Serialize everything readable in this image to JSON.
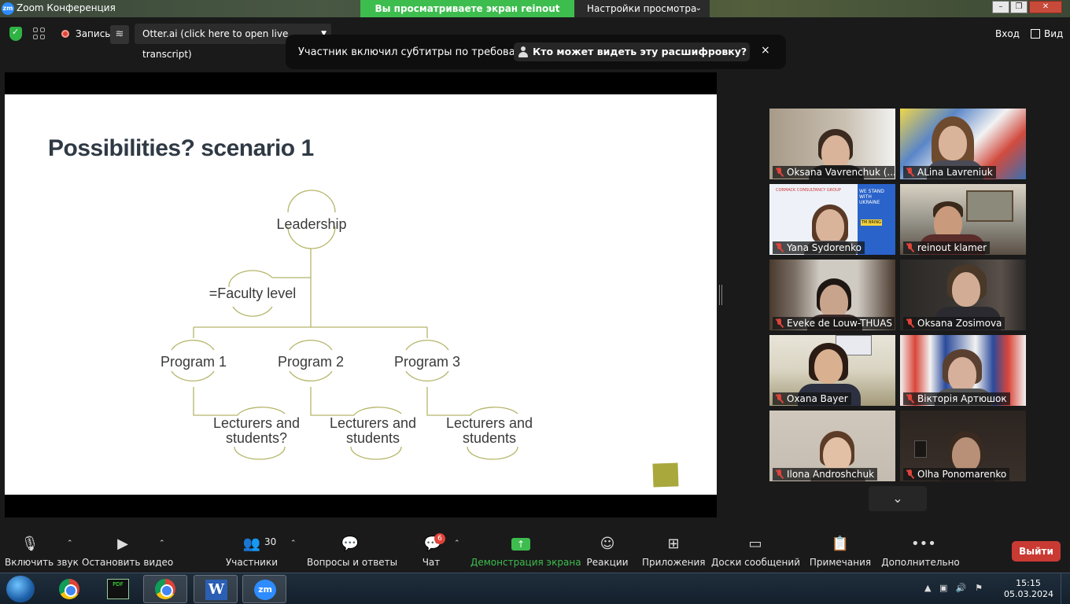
{
  "window": {
    "title": "Zoom Конференция",
    "logo_text": "zm",
    "share_banner": "Вы просматриваете экран reinout klamer",
    "view_settings": "Настройки просмотра",
    "minimize": "–",
    "restore": "❐",
    "close": "✕"
  },
  "topbar": {
    "record_label": "Запись",
    "otter_label": "Otter.ai (click here to open live transcript)",
    "enter_label": "Вход",
    "view_label": "Вид"
  },
  "notice": {
    "text": "Участник включил субтитры по требованию",
    "link": "Кто может видеть эту расшифровку? За...",
    "close": "×"
  },
  "slide": {
    "title": "Possibilities? scenario 1",
    "nodes": {
      "leadership": "Leadership",
      "faculty": "=Faculty level",
      "program1": "Program 1",
      "program2": "Program 2",
      "program3": "Program 3",
      "lect1_line1": "Lecturers and",
      "lect1_line2": "students?",
      "lect2_line1": "Lecturers and",
      "lect2_line2": "students",
      "lect3_line1": "Lecturers and",
      "lect3_line2": "students"
    }
  },
  "participants": [
    {
      "name": "Oksana Vavrenchuk (...",
      "muted": true
    },
    {
      "name": "ALina Lavreniuk",
      "muted": true
    },
    {
      "name": "Yana Sydorenko",
      "muted": true
    },
    {
      "name": "reinout klamer",
      "muted": true
    },
    {
      "name": "Eveke de Louw-THUAS",
      "muted": true
    },
    {
      "name": "Oksana Zosimova",
      "muted": true
    },
    {
      "name": "Oxana Bayer",
      "muted": true
    },
    {
      "name": "Вікторія Артюшок",
      "muted": true
    },
    {
      "name": "Ilona Androshchuk",
      "muted": true
    },
    {
      "name": "Olha Ponomarenko",
      "muted": true
    }
  ],
  "tile_banner": {
    "line1": "CORMACK CONSULTANCY GROUP",
    "line2": "WE STAND WITH UKRAINE",
    "line3": "TM BRING"
  },
  "toolbar": {
    "unmute": "Включить звук",
    "stop_video": "Остановить видео",
    "participants": "Участники",
    "participants_count": "30",
    "qa": "Вопросы и ответы",
    "chat": "Чат",
    "chat_badge": "6",
    "share": "Демонстрация экрана",
    "reactions": "Реакции",
    "apps": "Приложения",
    "whiteboards": "Доски сообщений",
    "notes": "Примечания",
    "more": "Дополнительно",
    "leave": "Выйти"
  },
  "taskbar": {
    "time": "15:15",
    "date": "05.03.2024",
    "pdf_label": "PDF",
    "word_label": "W",
    "zoom_label": "zm"
  },
  "colors": {
    "share_green": "#3ebd4f",
    "leave_red": "#c93a33",
    "active_speaker": "#cfe04a",
    "diagram_stroke": "#b5b56a"
  }
}
